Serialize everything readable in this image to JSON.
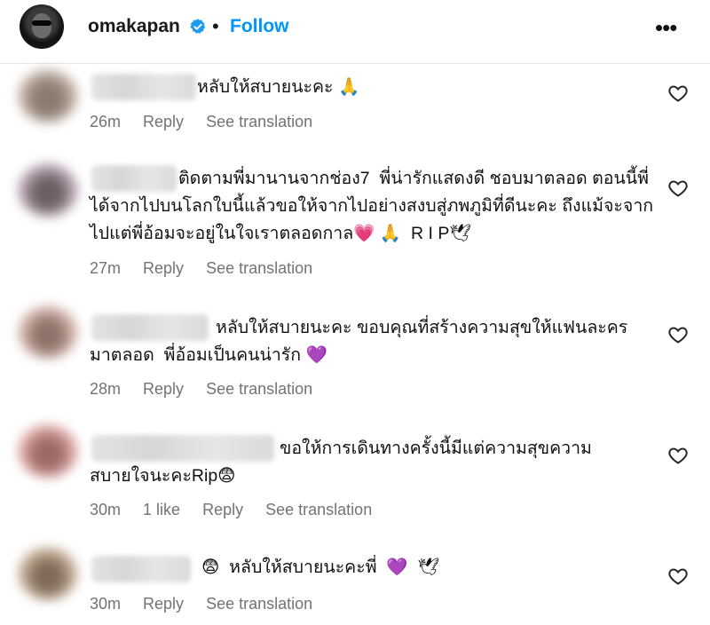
{
  "header": {
    "username": "omakapan",
    "separator": "•",
    "follow_label": "Follow",
    "more_label": "•••"
  },
  "comments": [
    {
      "text": "หลับให้สบายนะคะ 🙏",
      "time": "26m",
      "reply": "Reply",
      "translate": "See translation"
    },
    {
      "text": "ติดตามพี่มานานจากช่อง7  พี่น่ารักแสดงดี ชอบมาตลอด ตอนนี้พี่ได้จากไปบนโลกใบนี้แล้วขอให้จากไปอย่างสงบสู่ภพภูมิที่ดีนะคะ ถึงแม้จะจากไปแต่พี่อ้อมจะอยู่ในใจเราตลอดกาล💗 🙏  R I P🕊",
      "time": "27m",
      "reply": "Reply",
      "translate": "See translation"
    },
    {
      "text": "หลับให้สบายนะคะ ขอบคุณที่สร้างความสุขให้แฟนละครมาตลอด  พี่อ้อมเป็นคนน่ารัก 💜",
      "time": "28m",
      "reply": "Reply",
      "translate": "See translation"
    },
    {
      "text": "ขอให้การเดินทางครั้งนี้มีแต่ความสุขความสบายใจนะคะRip😨",
      "time": "30m",
      "likes": "1 like",
      "reply": "Reply",
      "translate": "See translation"
    },
    {
      "text": "😨  หลับให้สบายนะคะพี่  💜  🕊",
      "time": "30m",
      "reply": "Reply",
      "translate": "See translation"
    }
  ],
  "icons": {
    "verified": "verified-badge-icon",
    "heart": "heart-outline-icon",
    "more": "more-options-icon"
  },
  "colors": {
    "follow": "#0095f6",
    "verified": "#1d9bf0",
    "meta_text": "#737373"
  }
}
